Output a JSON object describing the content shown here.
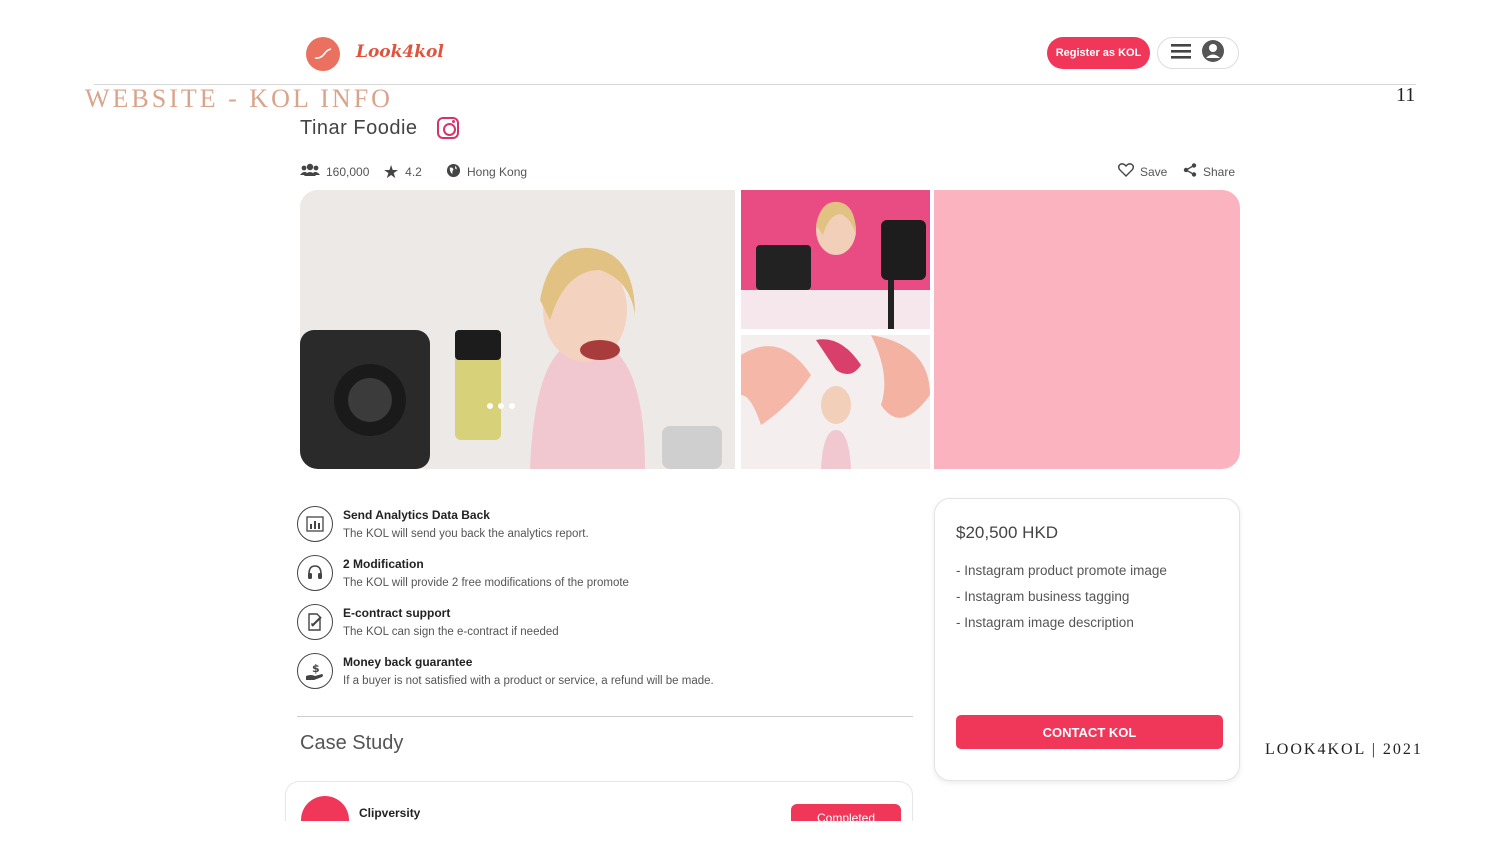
{
  "header": {
    "logo_text": "Look4kol",
    "register_label": "Register as KOL"
  },
  "slide": {
    "title": "WEBSITE - KOL INFO",
    "page_number": "11",
    "footer": "LOOK4KOL |  2021"
  },
  "kol": {
    "name": "Tinar  Foodie",
    "followers": "160,000",
    "rating": "4.2",
    "location": "Hong Kong",
    "save_label": "Save",
    "share_label": "Share"
  },
  "features": [
    {
      "title": "Send Analytics Data Back",
      "desc": "The KOL will send you back the analytics report.",
      "icon": "analytics-icon"
    },
    {
      "title": "2 Modification",
      "desc": "The KOL will provide 2 free modifications of the promote",
      "icon": "headset-icon"
    },
    {
      "title": "E-contract support",
      "desc": "The KOL can sign the e-contract if needed",
      "icon": "contract-icon"
    },
    {
      "title": "Money back guarantee",
      "desc": "If a buyer is not satisfied with a product or service, a refund will be made.",
      "icon": "money-back-icon"
    }
  ],
  "case_study": {
    "title": "Case Study",
    "name": "Clipversity",
    "status": "Completed"
  },
  "price_card": {
    "price": "$20,500 HKD",
    "items": [
      "- Instagram product promote image",
      "- Instagram business tagging",
      "- Instagram image description"
    ],
    "contact_label": "CONTACT KOL"
  },
  "colors": {
    "accent": "#f0375a",
    "pink_panel": "#fbb3c0",
    "title_color": "#d9a48c"
  }
}
